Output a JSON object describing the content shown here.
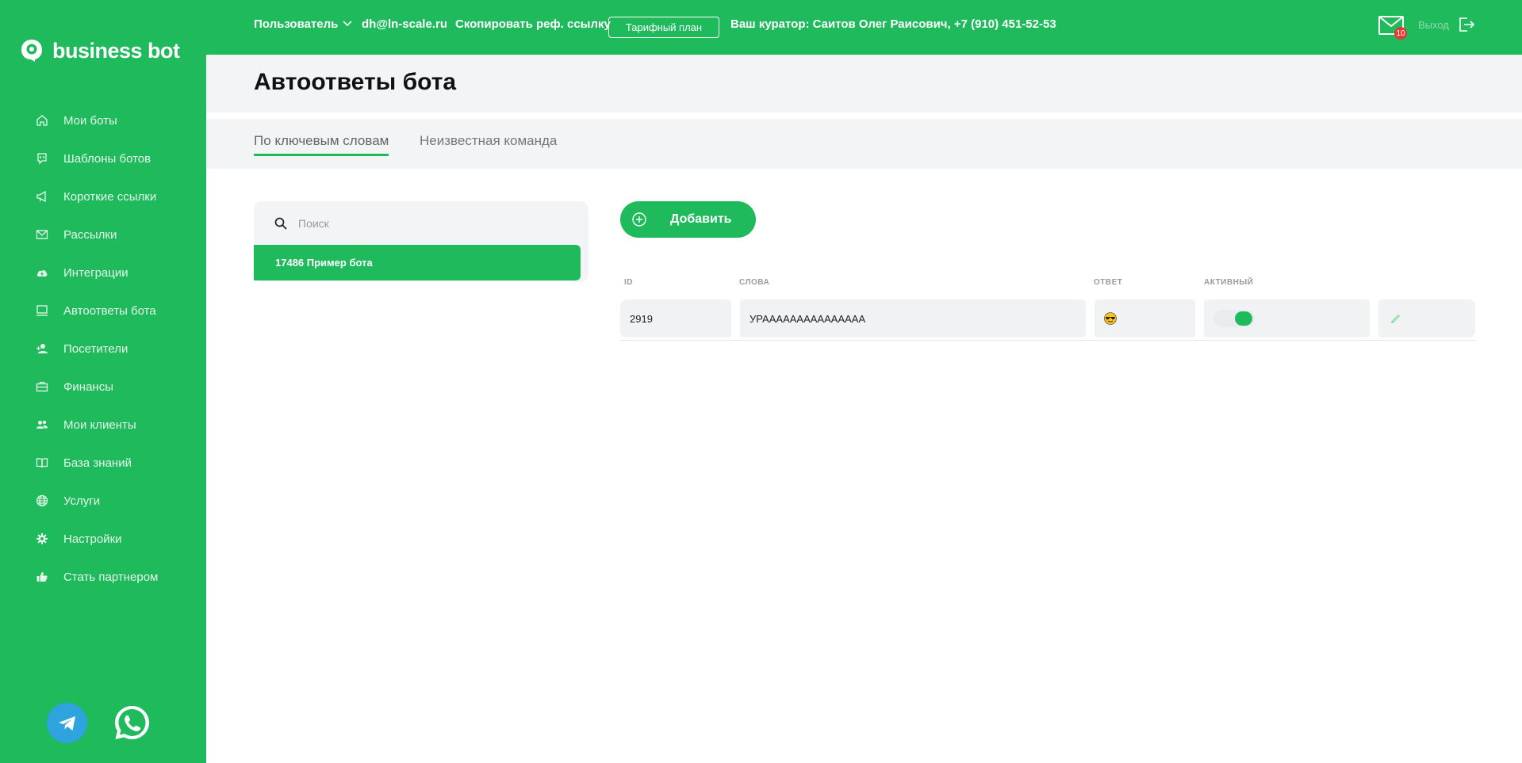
{
  "brand": {
    "name": "business bot"
  },
  "sidebar": {
    "items": [
      {
        "label": "Мои боты",
        "icon": "home-icon"
      },
      {
        "label": "Шаблоны ботов",
        "icon": "chat-icon"
      },
      {
        "label": "Короткие ссылки",
        "icon": "megaphone-icon"
      },
      {
        "label": "Рассылки",
        "icon": "envelope-icon"
      },
      {
        "label": "Интеграции",
        "icon": "cloud-upload-icon"
      },
      {
        "label": "Автоответы бота",
        "icon": "monitor-icon"
      },
      {
        "label": "Посетители",
        "icon": "user-add-icon"
      },
      {
        "label": "Финансы",
        "icon": "briefcase-icon"
      },
      {
        "label": "Мои клиенты",
        "icon": "users-icon"
      },
      {
        "label": "База знаний",
        "icon": "book-icon"
      },
      {
        "label": "Услуги",
        "icon": "globe-icon"
      },
      {
        "label": "Настройки",
        "icon": "gear-icon"
      },
      {
        "label": "Стать партнером",
        "icon": "thumbs-up-icon"
      }
    ],
    "social": [
      "telegram-icon",
      "whatsapp-icon"
    ]
  },
  "header": {
    "user_label": "Пользователь",
    "email": "dh@ln-scale.ru",
    "copy_ref": "Скопировать реф. ссылку",
    "tariff": "Тарифный план",
    "curator": "Ваш куратор: Саитов Олег Раисович, +7 (910) 451-52-53",
    "mail_count": "10",
    "logout": "Выход"
  },
  "page": {
    "title": "Автоответы бота",
    "tabs": [
      "По ключевым словам",
      "Неизвестная команда"
    ]
  },
  "left_panel": {
    "search_placeholder": "Поиск",
    "bot": "17486 Пример бота"
  },
  "add_label": "Добавить",
  "table": {
    "headers": [
      "ID",
      "СЛОВА",
      "ОТВЕТ",
      "АКТИВНЫЙ"
    ],
    "rows": [
      {
        "id": "2919",
        "words": "УРААААААААААААААА",
        "answer_icon": "sunglasses-emoji-icon",
        "active": true
      }
    ]
  },
  "colors": {
    "accent": "#1fba5c",
    "panel": "#f3f4f6",
    "badge": "#e53935",
    "telegram": "#2fa3de"
  }
}
